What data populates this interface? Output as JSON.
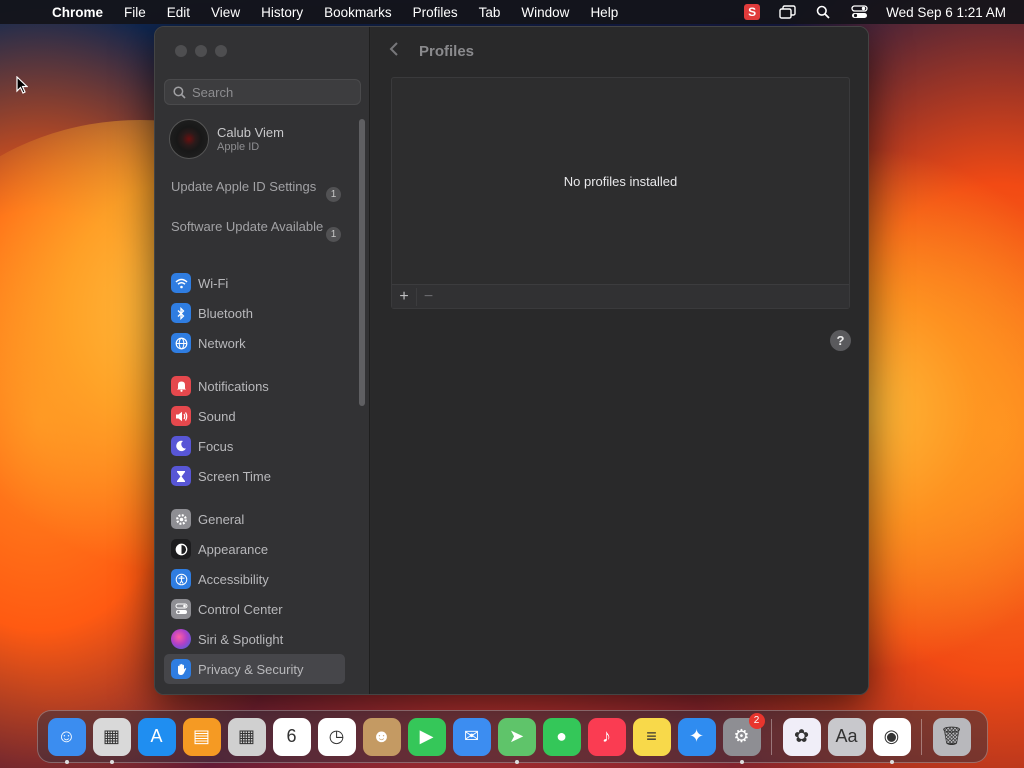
{
  "menubar": {
    "app_name": "Chrome",
    "items": [
      "File",
      "Edit",
      "View",
      "History",
      "Bookmarks",
      "Profiles",
      "Tab",
      "Window",
      "Help"
    ],
    "clock": "Wed Sep 6  1:21 AM",
    "status_s_label": "S"
  },
  "sidebar": {
    "search_placeholder": "Search",
    "account_name": "Calub Viem",
    "account_sub": "Apple ID",
    "notices": [
      {
        "label": "Update Apple ID Settings",
        "count": "1"
      },
      {
        "label": "Software Update Available",
        "count": "1"
      }
    ],
    "items": [
      {
        "label": "Wi-Fi",
        "icon": "wifi-icon",
        "color": "#2f7de1"
      },
      {
        "label": "Bluetooth",
        "icon": "bluetooth-icon",
        "color": "#2f7de1"
      },
      {
        "label": "Network",
        "icon": "globe-icon",
        "color": "#2f7de1"
      },
      {
        "label": "Notifications",
        "icon": "bell-icon",
        "color": "#e5484d"
      },
      {
        "label": "Sound",
        "icon": "speaker-icon",
        "color": "#e5484d"
      },
      {
        "label": "Focus",
        "icon": "moon-icon",
        "color": "#5856d6"
      },
      {
        "label": "Screen Time",
        "icon": "hourglass-icon",
        "color": "#5856d6"
      },
      {
        "label": "General",
        "icon": "gear-icon",
        "color": "#8e8e93"
      },
      {
        "label": "Appearance",
        "icon": "contrast-icon",
        "color": "#1c1c1e"
      },
      {
        "label": "Accessibility",
        "icon": "accessibility-icon",
        "color": "#2f7de1"
      },
      {
        "label": "Control Center",
        "icon": "switches-icon",
        "color": "#8e8e93"
      },
      {
        "label": "Siri & Spotlight",
        "icon": "siri-icon",
        "color": "#b040c8"
      },
      {
        "label": "Privacy & Security",
        "icon": "hand-icon",
        "color": "#2f7de1"
      }
    ]
  },
  "content": {
    "title": "Profiles",
    "empty_message": "No profiles installed",
    "add_label": "+",
    "remove_label": "−",
    "help_label": "?"
  },
  "dock": {
    "apps": [
      {
        "name": "finder",
        "color": "#3b8df0",
        "glyph": "☺",
        "running": true
      },
      {
        "name": "launchpad",
        "color": "#d9d9d9",
        "glyph": "▦",
        "running": true
      },
      {
        "name": "app-store",
        "color": "#1f8ef1",
        "glyph": "A",
        "running": false
      },
      {
        "name": "books",
        "color": "#f59a23",
        "glyph": "▤",
        "running": false
      },
      {
        "name": "calculator",
        "color": "#d0d0d0",
        "glyph": "▦",
        "running": false
      },
      {
        "name": "calendar",
        "color": "#ffffff",
        "glyph": "6",
        "running": false
      },
      {
        "name": "clock",
        "color": "#ffffff",
        "glyph": "◷",
        "running": false
      },
      {
        "name": "contacts",
        "color": "#c49a63",
        "glyph": "☻",
        "running": false
      },
      {
        "name": "facetime",
        "color": "#35c759",
        "glyph": "▶",
        "running": false
      },
      {
        "name": "mail",
        "color": "#3c8df1",
        "glyph": "✉",
        "running": false
      },
      {
        "name": "maps",
        "color": "#5fc46a",
        "glyph": "➤",
        "running": true
      },
      {
        "name": "messages",
        "color": "#34c759",
        "glyph": "●",
        "running": false
      },
      {
        "name": "music",
        "color": "#fa3c52",
        "glyph": "♪",
        "running": false
      },
      {
        "name": "notes",
        "color": "#f8d94a",
        "glyph": "≡",
        "running": false
      },
      {
        "name": "safari",
        "color": "#2f8cf0",
        "glyph": "✦",
        "running": false
      },
      {
        "name": "system-settings",
        "color": "#8e8e93",
        "glyph": "⚙",
        "running": true,
        "badge": "2"
      },
      {
        "name": "chrome-settings",
        "color": "#f0eef8",
        "glyph": "✿",
        "running": false
      },
      {
        "name": "font-book",
        "color": "#c8c8cc",
        "glyph": "Aa",
        "running": false
      },
      {
        "name": "chrome",
        "color": "#ffffff",
        "glyph": "◉",
        "running": true
      },
      {
        "name": "trash",
        "color": "#b8b8bc",
        "glyph": "🗑",
        "running": false
      }
    ]
  }
}
